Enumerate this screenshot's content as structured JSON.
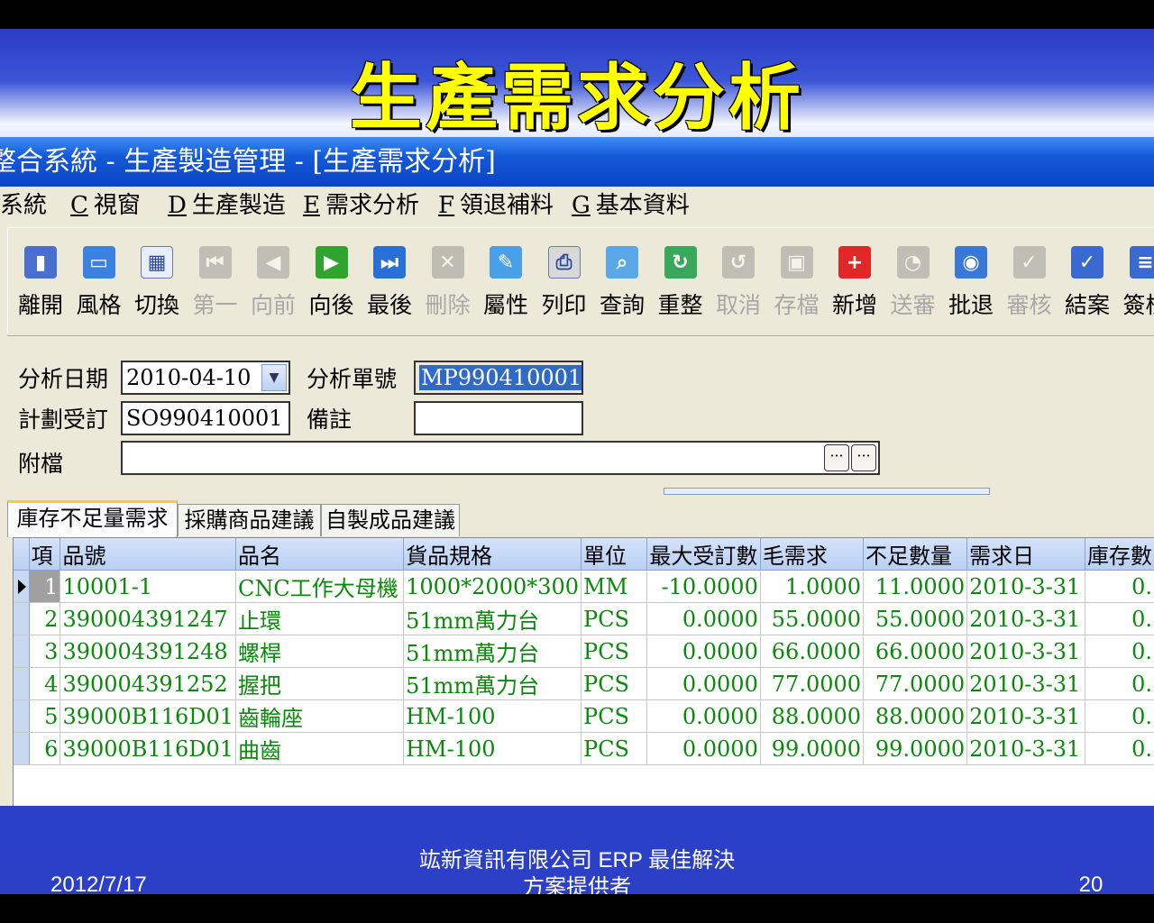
{
  "slide": {
    "title": "生產需求分析",
    "date": "2012/7/17",
    "company_line1": "竑新資訊有限公司  ERP 最佳解決",
    "company_line2": "方案提供者",
    "page_number": "20"
  },
  "window": {
    "title": "整合系統 - 生產製造管理 - [生產需求分析]"
  },
  "menu": [
    {
      "key": "B",
      "label": "系統"
    },
    {
      "key": "C",
      "label": "視窗"
    },
    {
      "key": "D",
      "label": "生產製造"
    },
    {
      "key": "E",
      "label": "需求分析"
    },
    {
      "key": "F",
      "label": "領退補料"
    },
    {
      "key": "G",
      "label": "基本資料"
    }
  ],
  "toolbar": [
    {
      "label": "離開",
      "icon": "exit-door-icon",
      "enabled": true
    },
    {
      "label": "風格",
      "icon": "window-style-icon",
      "enabled": true
    },
    {
      "label": "切換",
      "icon": "grid-toggle-icon",
      "enabled": true
    },
    {
      "label": "第一",
      "icon": "first-record-icon",
      "enabled": false
    },
    {
      "label": "向前",
      "icon": "previous-record-icon",
      "enabled": false
    },
    {
      "label": "向後",
      "icon": "next-record-icon",
      "enabled": true
    },
    {
      "label": "最後",
      "icon": "last-record-icon",
      "enabled": true
    },
    {
      "label": "刪除",
      "icon": "delete-x-icon",
      "enabled": false
    },
    {
      "label": "屬性",
      "icon": "properties-icon",
      "enabled": true
    },
    {
      "label": "列印",
      "icon": "printer-icon",
      "enabled": true
    },
    {
      "label": "查詢",
      "icon": "magnifier-icon",
      "enabled": true
    },
    {
      "label": "重整",
      "icon": "refresh-icon",
      "enabled": true
    },
    {
      "label": "取消",
      "icon": "undo-icon",
      "enabled": false
    },
    {
      "label": "存檔",
      "icon": "save-disk-icon",
      "enabled": false
    },
    {
      "label": "新增",
      "icon": "add-plus-icon",
      "enabled": true
    },
    {
      "label": "送審",
      "icon": "submit-review-icon",
      "enabled": false
    },
    {
      "label": "批退",
      "icon": "reject-icon",
      "enabled": true
    },
    {
      "label": "審核",
      "icon": "approve-check-icon",
      "enabled": false
    },
    {
      "label": "結案",
      "icon": "close-case-icon",
      "enabled": true
    },
    {
      "label": "簽核",
      "icon": "sign-off-icon",
      "enabled": true
    }
  ],
  "form": {
    "analysis_date_label": "分析日期",
    "analysis_date_value": "2010-04-10",
    "analysis_no_label": "分析單號",
    "analysis_no_value": "MP990410001",
    "plan_order_label": "計劃受訂",
    "plan_order_value": "SO990410001",
    "remark_label": "備註",
    "remark_value": "",
    "attachment_label": "附檔",
    "attachment_value": ""
  },
  "tabs": [
    {
      "label": "庫存不足量需求",
      "active": true
    },
    {
      "label": "採購商品建議",
      "active": false
    },
    {
      "label": "自製成品建議",
      "active": false
    }
  ],
  "grid": {
    "columns": [
      "項",
      "品號",
      "品名",
      "貨品規格",
      "單位",
      "最大受訂數",
      "毛需求",
      "不足數量",
      "需求日",
      "庫存數"
    ],
    "rows": [
      [
        "1",
        "10001-1",
        "CNC工作大母機",
        "1000*2000*300",
        "MM",
        "-10.0000",
        "1.0000",
        "11.0000",
        "2010-3-31",
        "0."
      ],
      [
        "2",
        "390004391247",
        "止環",
        "51mm萬力台",
        "PCS",
        "0.0000",
        "55.0000",
        "55.0000",
        "2010-3-31",
        "0."
      ],
      [
        "3",
        "390004391248",
        "螺桿",
        "51mm萬力台",
        "PCS",
        "0.0000",
        "66.0000",
        "66.0000",
        "2010-3-31",
        "0."
      ],
      [
        "4",
        "390004391252",
        "握把",
        "51mm萬力台",
        "PCS",
        "0.0000",
        "77.0000",
        "77.0000",
        "2010-3-31",
        "0."
      ],
      [
        "5",
        "39000B116D01",
        "齒輪座",
        "HM-100",
        "PCS",
        "0.0000",
        "88.0000",
        "88.0000",
        "2010-3-31",
        "0."
      ],
      [
        "6",
        "39000B116D01",
        "曲齒",
        "HM-100",
        "PCS",
        "0.0000",
        "99.0000",
        "99.0000",
        "2010-3-31",
        "0."
      ]
    ],
    "current_row": 0
  },
  "colors": {
    "title_yellow": "#ffff00",
    "grid_text_green": "#0a8a0a",
    "window_titlebar_blue": "#1458d8",
    "selection_blue": "#3169c6"
  }
}
